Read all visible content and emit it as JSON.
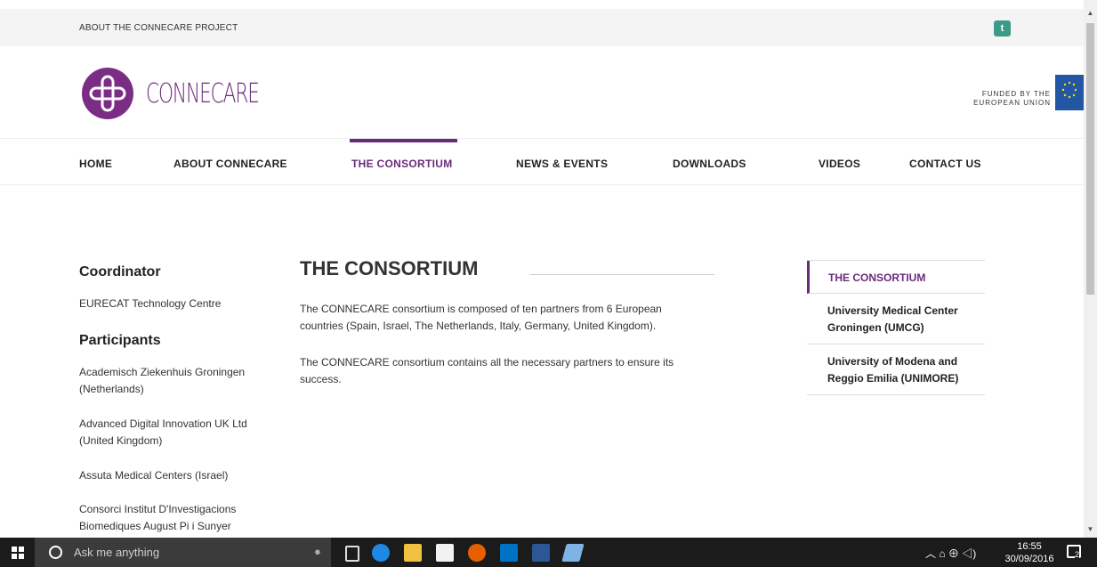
{
  "topbar": {
    "about": "ABOUT THE CONNECARE PROJECT",
    "twitter_icon": "twitter-icon"
  },
  "header": {
    "logo_text": "CONNECARE",
    "funded_line1": "FUNDED BY THE",
    "funded_line2": "EUROPEAN UNION"
  },
  "nav": {
    "items": [
      "HOME",
      "ABOUT CONNECARE",
      "THE CONSORTIUM",
      "NEWS & EVENTS",
      "DOWNLOADS",
      "VIDEOS",
      "CONTACT US"
    ],
    "active": "THE CONSORTIUM"
  },
  "sidebar": {
    "coordinator_heading": "Coordinator",
    "coordinator": "EURECAT Technology Centre",
    "participants_heading": "Participants",
    "participants": [
      "Academisch Ziekenhuis Groningen (Netherlands)",
      "Advanced Digital Innovation UK Ltd (United Kingdom)",
      "Assuta Medical Centers (Israel)",
      "Consorci Institut D'Investigacions Biomediques August Pi i Sunyer"
    ]
  },
  "main": {
    "title": "THE CONSORTIUM",
    "para1": "The CONNECARE consortium is composed of ten partners from 6 European countries (Spain, Israel, The Netherlands, Italy, Germany, United Kingdom).",
    "para2": "The CONNECARE consortium contains all the necessary partners to ensure its success."
  },
  "right_nav": {
    "items": [
      "THE CONSORTIUM",
      "University Medical Center Groningen (UMCG)",
      "University of Modena and Reggio Emilia (UNIMORE)"
    ]
  },
  "taskbar": {
    "search_placeholder": "Ask me anything",
    "time": "16:55",
    "date": "30/09/2016",
    "notification_count": "2"
  },
  "colors": {
    "brand_purple": "#6a2a7a",
    "taskbar": "#1b1b1b"
  }
}
